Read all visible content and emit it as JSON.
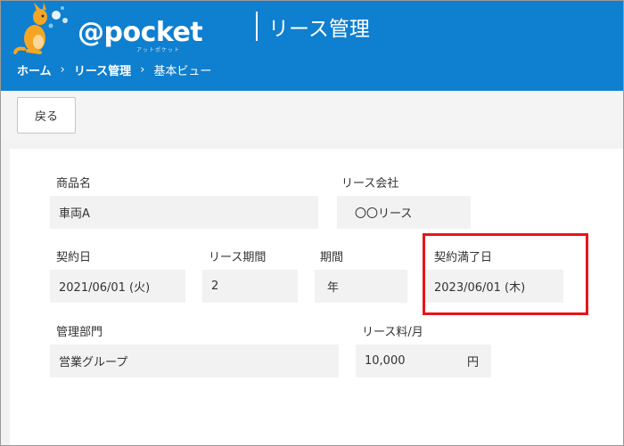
{
  "header": {
    "logo_text": "@pocket",
    "logo_sub": "アットポケット",
    "app_title": "リース管理",
    "breadcrumb": [
      "ホーム",
      "リース管理",
      "基本ビュー"
    ],
    "breadcrumb_separator": "›",
    "brand_color": "#0f7fcf"
  },
  "toolbar": {
    "back_label": "戻る"
  },
  "form": {
    "product_name": {
      "label": "商品名",
      "value": "車両A"
    },
    "lease_company": {
      "label": "リース会社",
      "value": "〇〇リース"
    },
    "contract_date": {
      "label": "契約日",
      "value": "2021/06/01 (火)"
    },
    "lease_period": {
      "label": "リース期間",
      "value": "2"
    },
    "period_unit": {
      "label": "期間",
      "value": "年"
    },
    "contract_end_date": {
      "label": "契約満了日",
      "value": "2023/06/01 (木)"
    },
    "department": {
      "label": "管理部門",
      "value": "営業グループ"
    },
    "monthly_fee": {
      "label": "リース料/月",
      "value": "10,000",
      "unit": "円"
    }
  },
  "highlight_color": "#e8141b"
}
